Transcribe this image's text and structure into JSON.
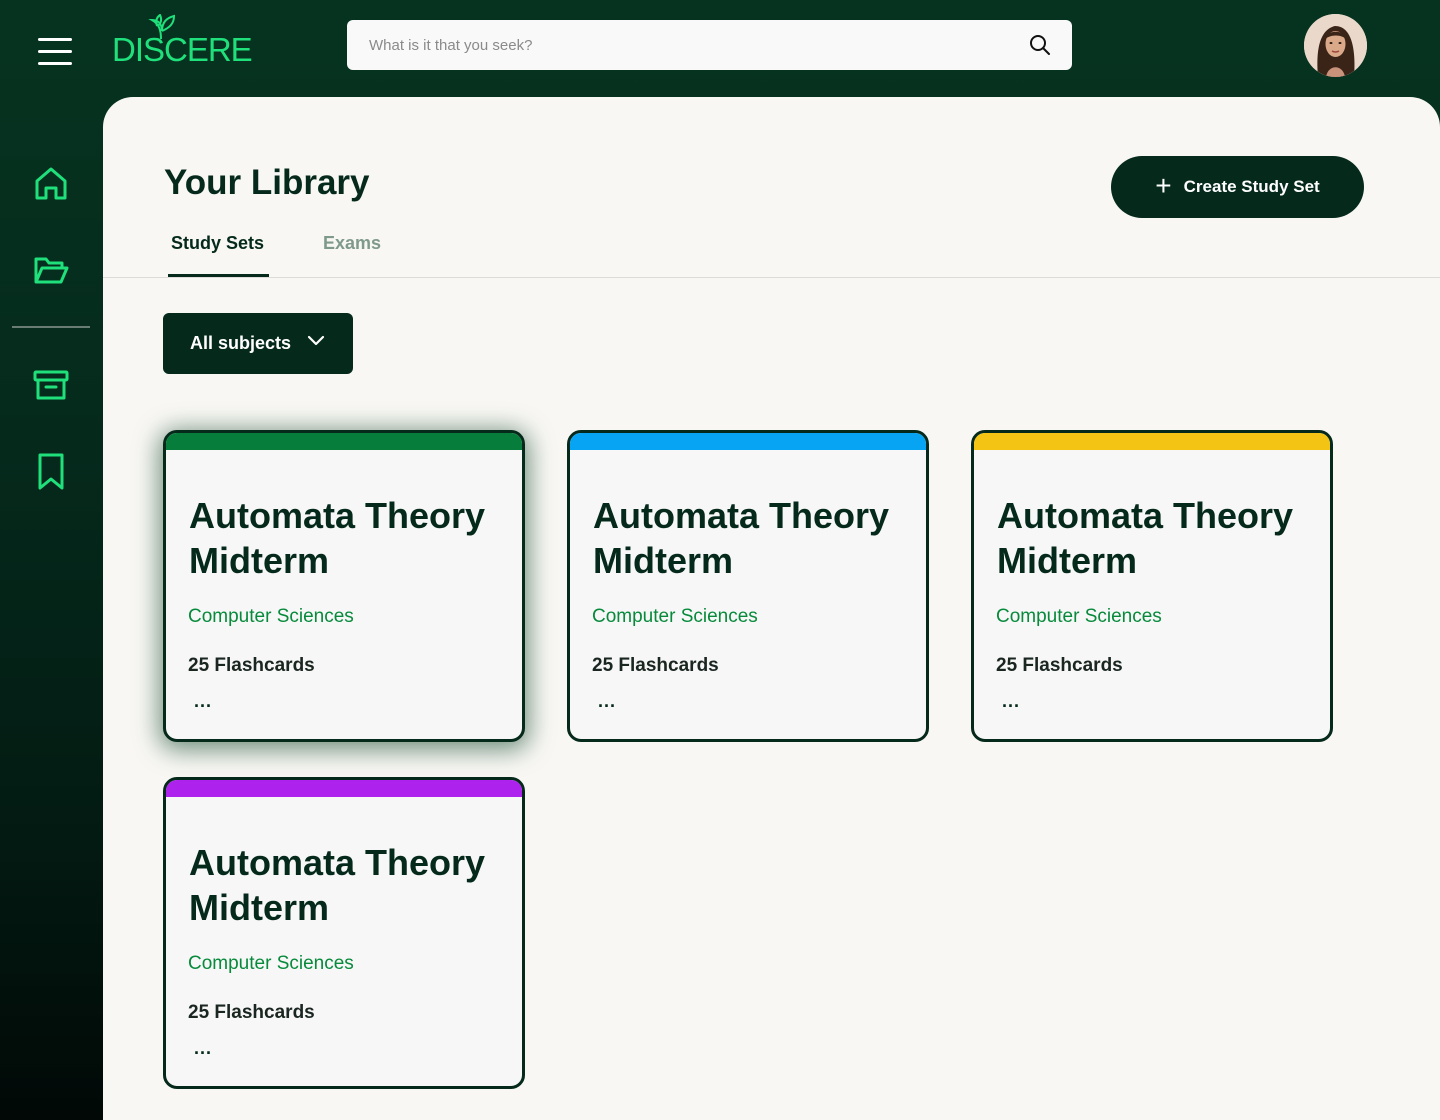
{
  "app": {
    "logo_text": "DISCERE"
  },
  "search": {
    "placeholder": "What is it that you seek?"
  },
  "sidebar": {
    "items": [
      "home-icon",
      "folder-icon",
      "archive-icon",
      "bookmark-icon"
    ]
  },
  "main": {
    "title": "Your Library",
    "create_label": "Create Study Set",
    "tabs": [
      {
        "label": "Study Sets",
        "active": true
      },
      {
        "label": "Exams",
        "active": false
      }
    ],
    "filter_label": "All subjects"
  },
  "cards": [
    {
      "title": "Automata Theory Midterm",
      "subject": "Computer Sciences",
      "count": "25 Flashcards",
      "more": "...",
      "accent": "#067d3a"
    },
    {
      "title": "Automata Theory Midterm",
      "subject": "Computer Sciences",
      "count": "25 Flashcards",
      "more": "...",
      "accent": "#06a4f2"
    },
    {
      "title": "Automata Theory Midterm",
      "subject": "Computer Sciences",
      "count": "25 Flashcards",
      "more": "...",
      "accent": "#f3c414"
    },
    {
      "title": "Automata Theory Midterm",
      "subject": "Computer Sciences",
      "count": "25 Flashcards",
      "more": "...",
      "accent": "#ad22ec"
    }
  ],
  "colors": {
    "brand": "#052a1c",
    "accent_green": "#1fe07a",
    "subject_green": "#088a3c"
  }
}
